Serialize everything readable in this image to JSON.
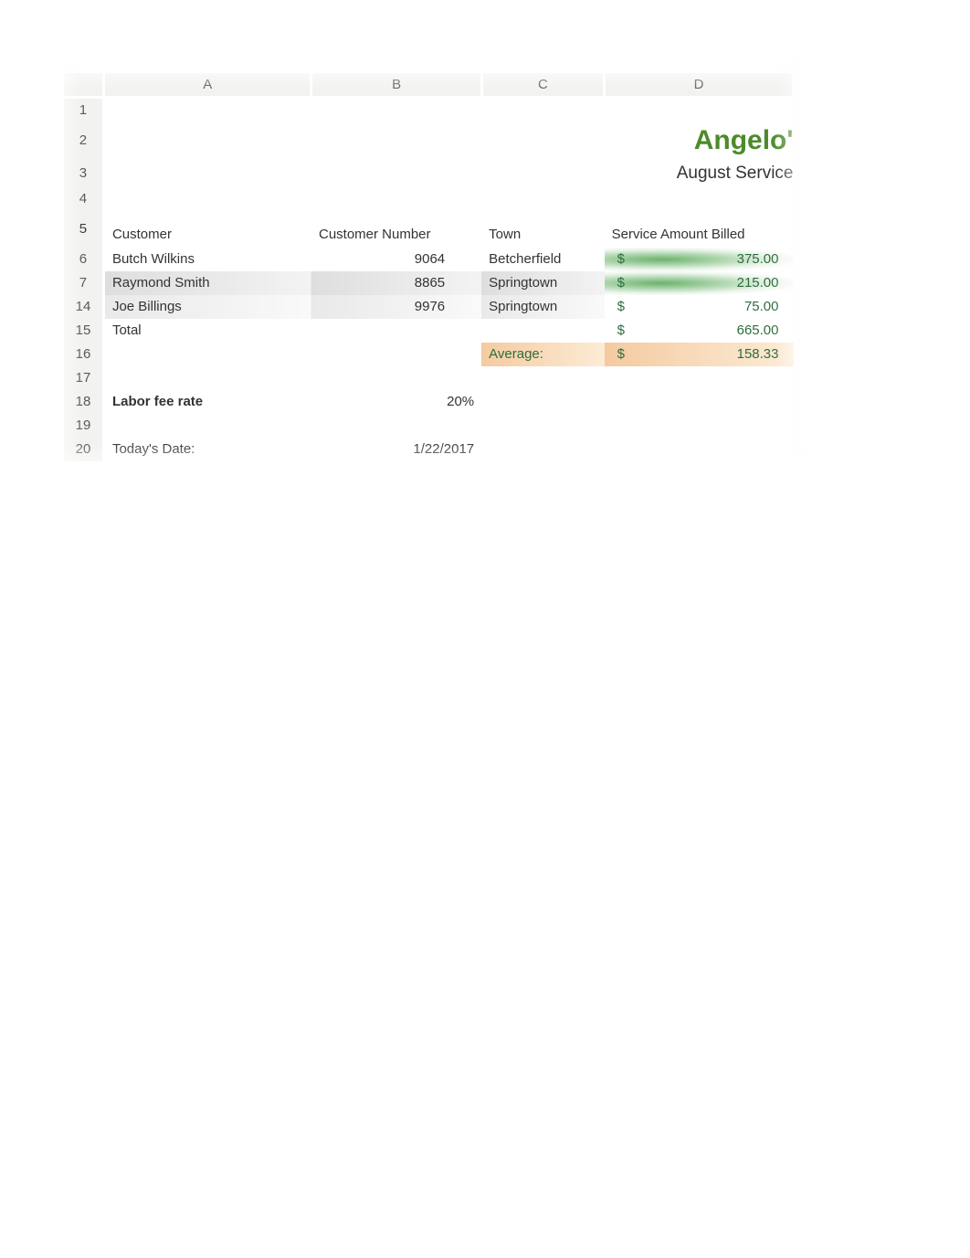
{
  "columns": [
    "A",
    "B",
    "C",
    "D"
  ],
  "rowNumbers": [
    "1",
    "2",
    "3",
    "4",
    "5",
    "6",
    "7",
    "14",
    "15",
    "16",
    "17",
    "18",
    "19",
    "20"
  ],
  "title": "Angelo'",
  "subtitle": "August Service",
  "headers": {
    "customer": "Customer",
    "customerNumber": "Customer Number",
    "town": "Town",
    "serviceAmount": "Service Amount Billed"
  },
  "rows": [
    {
      "customer": "Butch Wilkins",
      "customerNumber": "9064",
      "town": "Betcherfield",
      "amount": "375.00"
    },
    {
      "customer": "Raymond Smith",
      "customerNumber": "8865",
      "town": "Springtown",
      "amount": "215.00"
    },
    {
      "customer": "Joe Billings",
      "customerNumber": "9976",
      "town": "Springtown",
      "amount": "75.00"
    }
  ],
  "totals": {
    "label": "Total",
    "amount": "665.00"
  },
  "average": {
    "label": "Average:",
    "amount": "158.33"
  },
  "laborFee": {
    "label": "Labor fee rate",
    "value": "20%"
  },
  "today": {
    "label": "Today's Date:",
    "value": "1/22/2017"
  },
  "currencySymbol": "$"
}
